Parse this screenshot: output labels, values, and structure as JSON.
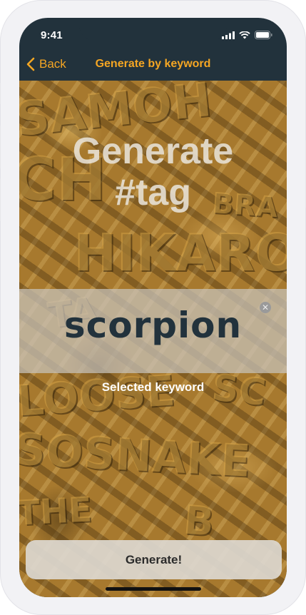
{
  "status_bar": {
    "time": "9:41"
  },
  "nav": {
    "back_label": "Back",
    "title": "Generate by keyword"
  },
  "headline": {
    "line1": "Generate",
    "line2": "#tag"
  },
  "keyword": {
    "value": "scorpion",
    "caption": "Selected keyword",
    "clear_icon": "x-circle-icon"
  },
  "generate_button": {
    "label": "Generate!"
  },
  "colors": {
    "accent": "#f5a623",
    "dark": "#22323c",
    "text_light": "#ffffff"
  },
  "background_art": {
    "icon": "graffiti-wall-image",
    "painted_words": [
      "SAMOH",
      "CH",
      "BRA",
      "HIKARO",
      "TA",
      "LOOSE",
      "SC",
      "SOSNAKE",
      "THE",
      "B"
    ]
  }
}
